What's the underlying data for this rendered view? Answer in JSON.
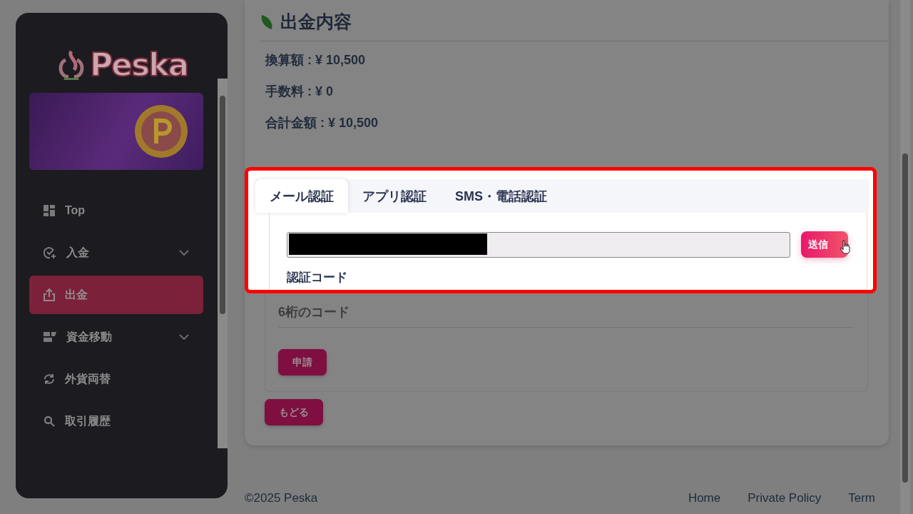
{
  "sidebar": {
    "logo": "Peska",
    "items": [
      {
        "label": "Top",
        "selected": false,
        "kind": "link"
      },
      {
        "label": "入金",
        "selected": false,
        "kind": "group"
      },
      {
        "label": "出金",
        "selected": true,
        "kind": "link"
      },
      {
        "label": "資金移動",
        "selected": false,
        "kind": "group"
      },
      {
        "label": "外貨両替",
        "selected": false,
        "kind": "link"
      },
      {
        "label": "取引履歴",
        "selected": false,
        "kind": "link"
      }
    ]
  },
  "withdrawal": {
    "title": "出金内容",
    "lines": [
      "換算額 : ¥ 10,500",
      "手数料 : ¥ 0",
      "合計金額 : ¥ 10,500"
    ]
  },
  "verification": {
    "tabs": [
      {
        "label": "メール認証",
        "selected": true
      },
      {
        "label": "アプリ認証",
        "selected": false
      },
      {
        "label": "SMS・電話認証",
        "selected": false
      }
    ],
    "send_button": "送信",
    "code_label": "認証コード",
    "code_field": {
      "placeholder": "6桁のコード"
    },
    "apply_button": "申請"
  },
  "back_button": "もどる",
  "footer": {
    "copyright": "©2025 Peska",
    "links": [
      "Home",
      "Private Policy",
      "Term"
    ]
  }
}
